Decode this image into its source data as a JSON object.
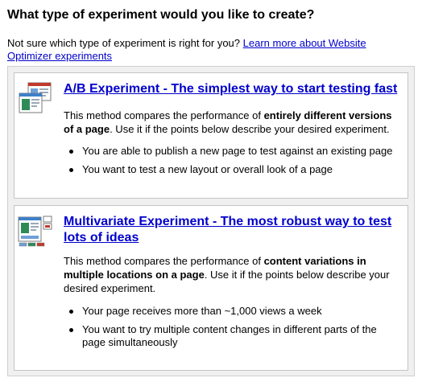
{
  "header": {
    "title": "What type of experiment would you like to create?"
  },
  "intro": {
    "text": "Not sure which type of experiment is right for you?",
    "link": "Learn more about Website Optimizer experiments"
  },
  "options": [
    {
      "title": "A/B Experiment - The simplest way to start testing fast",
      "icon": "ab-test-icon",
      "desc_pre": "This method compares the performance of ",
      "desc_bold": "entirely different versions of a page",
      "desc_post": ". Use it if the points below describe your desired experiment.",
      "bullets": [
        "You are able to publish a new page to test against an existing page",
        "You want to test a new layout or overall look of a page"
      ]
    },
    {
      "title": "Multivariate Experiment - The most robust way to test lots of ideas",
      "icon": "multivariate-test-icon",
      "desc_pre": "This method compares the performance of ",
      "desc_bold": "content variations in multiple locations on a page",
      "desc_post": ". Use it if the points below describe your desired experiment.",
      "bullets": [
        "Your page receives more than ~1,000 views a week",
        "You want to try multiple content changes in different parts of the page simultaneously"
      ]
    }
  ],
  "colors": {
    "link": "#0000cc",
    "panel_bg": "#f0f0f0",
    "card_border": "#c4c4c4"
  }
}
